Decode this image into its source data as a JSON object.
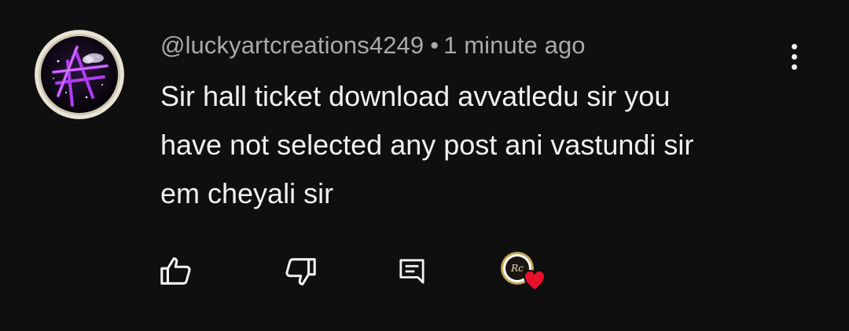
{
  "comment": {
    "author": "@luckyartcreations4249",
    "separator": "•",
    "time": "1 minute ago",
    "text_lines": [
      "Sir hall ticket download avvatledu sir you",
      "have not selected any post ani vastundi sir",
      "em cheyali sir"
    ]
  },
  "icons": {
    "more": "more-vert-icon",
    "like": "thumb-up-icon",
    "dislike": "thumb-down-icon",
    "reply": "comment-icon",
    "creator_heart": "creator-heart-icon"
  },
  "colors": {
    "background": "#0f0f0f",
    "text_primary": "#f1f1f1",
    "text_secondary": "#aaaaaa",
    "heart": "#e8102a",
    "avatar_accent": "#b03cf0"
  }
}
